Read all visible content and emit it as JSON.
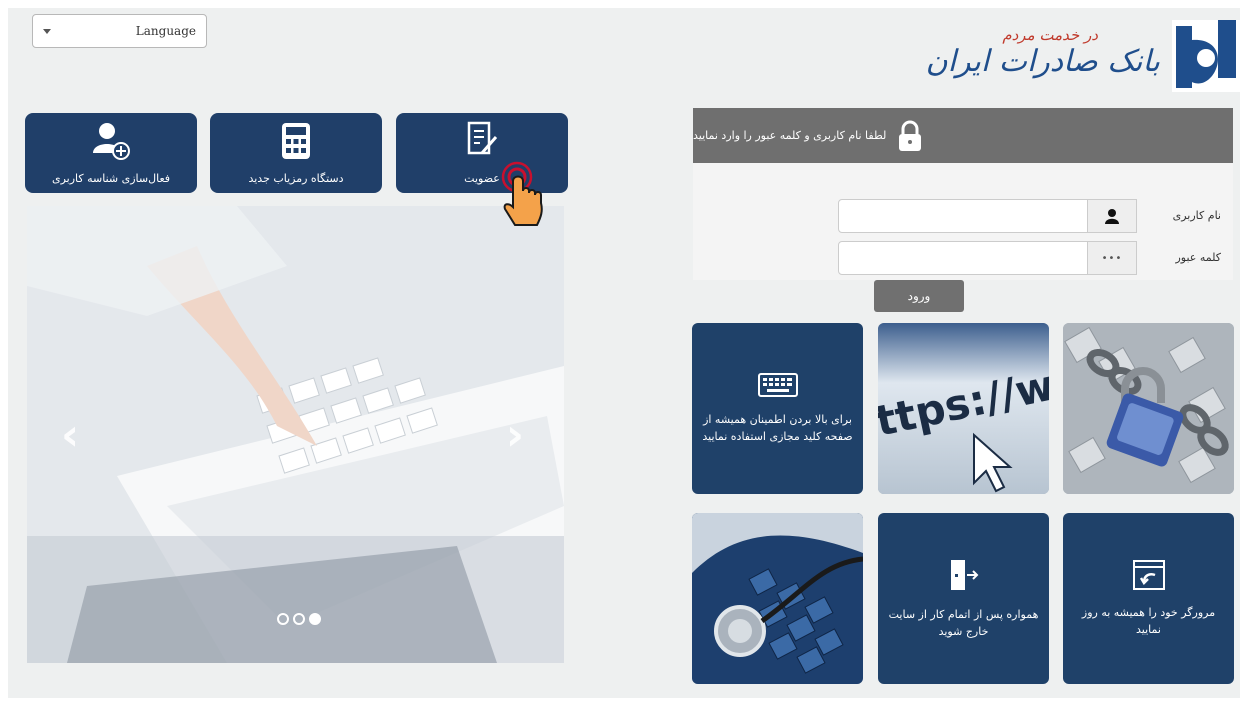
{
  "language": {
    "label": "Language"
  },
  "logo": {
    "name": "بانک صادرات ایران",
    "tagline": "در خدمت مردم"
  },
  "actions": [
    {
      "label": "عضویت",
      "icon": "document-pen-icon"
    },
    {
      "label": "دستگاه رمزیاب جدید",
      "icon": "calculator-icon"
    },
    {
      "label": "فعال‌سازی شناسه کاربری",
      "icon": "user-add-icon"
    }
  ],
  "login": {
    "header": "لطفا نام کاربری و کلمه عبور را وارد نمایید",
    "username_label": "نام کاربری",
    "password_label": "کلمه عبور",
    "username_value": "",
    "password_value": "",
    "password_addon": "•••",
    "submit": "ورود"
  },
  "tiles": {
    "keyboard": "برای بالا بردن اطمینان همیشه از صفحه کلید مجازی استفاده نمایید",
    "https": "ttps://w",
    "logout": "همواره پس از اتمام کار از سایت خارج شوید",
    "browser": "مرورگر خود را همیشه به روز نمایید"
  },
  "carousel": {
    "slide_count": 3,
    "active_slide": 3
  },
  "colors": {
    "tile_blue": "#1f4169",
    "header_gray": "#6f6f6f",
    "brand_blue": "#1f4e8c",
    "brand_red": "#c0392b"
  }
}
